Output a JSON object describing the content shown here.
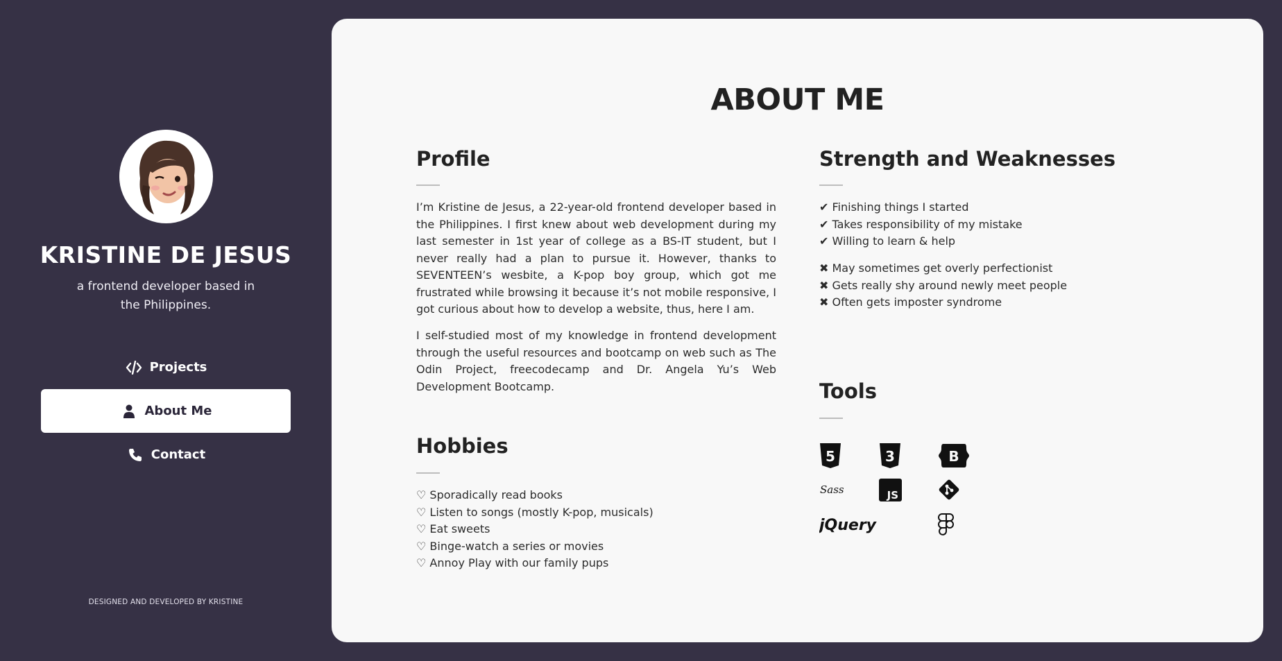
{
  "sidebar": {
    "name": "KRISTINE DE JESUS",
    "tagline": "a frontend developer based in the Philippines.",
    "nav": [
      {
        "label": "Projects",
        "icon": "code-icon",
        "active": false
      },
      {
        "label": "About Me",
        "icon": "user-icon",
        "active": true
      },
      {
        "label": "Contact",
        "icon": "phone-icon",
        "active": false
      }
    ],
    "footer": "DESIGNED AND DEVELOPED BY KRISTINE"
  },
  "main": {
    "title": "ABOUT ME",
    "profile": {
      "heading": "Profile",
      "paragraphs": [
        "I’m Kristine de Jesus, a 22-year-old frontend developer based in the Philippines. I first knew about web development during my last semester in 1st year of college as a BS-IT student, but I never really had a plan to pursue it. However, thanks to SEVENTEEN’s wesbite, a K-pop boy group, which got me frustrated while browsing it because it’s not mobile responsive, I got curious about how to develop a website, thus, here I am.",
        "I self-studied most of my knowledge in frontend development through the useful resources and bootcamp on web such as The Odin Project, freecodecamp and Dr. Angela Yu’s Web Development Bootcamp."
      ]
    },
    "hobbies": {
      "heading": "Hobbies",
      "items": [
        "♡ Sporadically read books",
        "♡ Listen to songs (mostly K-pop, musicals)",
        "♡ Eat sweets",
        "♡ Binge-watch a series or movies",
        "♡ Annoy Play with our family pups"
      ]
    },
    "strengths": {
      "heading": "Strength and Weaknesses",
      "strengths": [
        "✔ Finishing things I started",
        "✔ Takes responsibility of my mistake",
        "✔ Willing to learn & help"
      ],
      "weaknesses": [
        "✖ May sometimes get overly perfectionist",
        "✖ Gets really shy around newly meet people",
        "✖ Often gets imposter syndrome"
      ]
    },
    "tools": {
      "heading": "Tools",
      "icons": [
        "html5-icon",
        "css3-icon",
        "bootstrap-icon",
        "sass-icon",
        "javascript-icon",
        "git-icon",
        "jquery-icon",
        "figma-icon"
      ],
      "sass_text": "Sass",
      "jquery_text": "jQuery",
      "js_text": "JS",
      "bootstrap_text": "B",
      "html_text": "5",
      "css_text": "3"
    }
  },
  "colors": {
    "sidebar_bg": "#363145",
    "panel_bg": "#f8f8f8",
    "text_dark": "#212121"
  }
}
